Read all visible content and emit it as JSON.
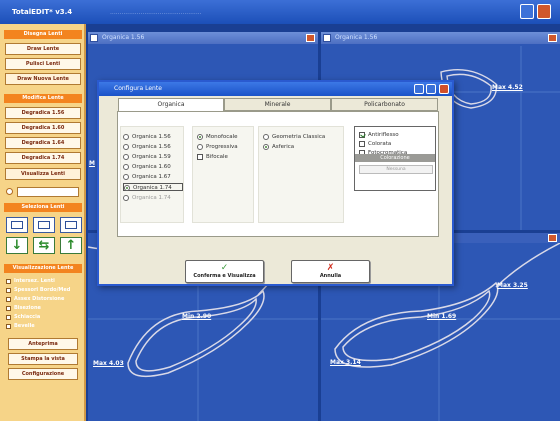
{
  "app": {
    "title": "TotalEDIT* v3.4",
    "faint_title": "................................................"
  },
  "sidebar": {
    "header1": "Disegna Lenti",
    "btn_disegna": "Draw Lente",
    "btn_pulisci": "Pulisci Lenti",
    "btn_nuova": "Draw Nuova Lente",
    "header2": "Modifica Lente",
    "btn_d1": "Degradica 1.56",
    "btn_d2": "Degradica 1.60",
    "btn_d3": "Degradica 1.64",
    "btn_d4": "Degradica 1.74",
    "btn_visual": "Visualizza Lenti",
    "header3": "Seleziona Lenti",
    "header4": "Visualizzazione Lente",
    "checks": [
      "Intersez. Lenti",
      "Spessori Bordo/Med",
      "Assex Distorsione",
      "Bisezione",
      "Schiaccia",
      "Bevelle"
    ],
    "btn_anteprima": "Anteprima",
    "btn_stampa": "Stampa la vista",
    "btn_config": "Configurazione"
  },
  "panels": {
    "top_left": {
      "title": "Organica 1.56",
      "measure_left": "M"
    },
    "top_right": {
      "title": "Organica 1.56",
      "measure": "Max 4.52"
    },
    "bottom_left": {
      "measure_center": "Min 2.90",
      "measure_bottom": "Max 4.03"
    },
    "bottom_right": {
      "measure_right": "Max 3.25",
      "measure_center": "Min 1.69",
      "measure_bottom": "Max 3.14"
    }
  },
  "dialog": {
    "title": "Configura Lente",
    "tabs": [
      "Organica",
      "Minerale",
      "Policarbonato"
    ],
    "active_tab": "Organica",
    "materials": [
      "Organica 1.56",
      "Organica 1.56",
      "Organica 1.59",
      "Organica 1.60",
      "Organica 1.67",
      "Organica 1.74",
      "Organica 1.74"
    ],
    "design": [
      "Monofocale",
      "Progressiva",
      "Bifocale"
    ],
    "geometry": [
      "Geometria Classica",
      "Asferica"
    ],
    "treatments": [
      "Antiriflesso",
      "Colorata",
      "Fotocromatica"
    ],
    "colorazione_header": "Colorazione",
    "colorazione_value": "Nessuna",
    "confirm_label": "Conferma e Visualizza",
    "cancel_label": "Annulla"
  }
}
